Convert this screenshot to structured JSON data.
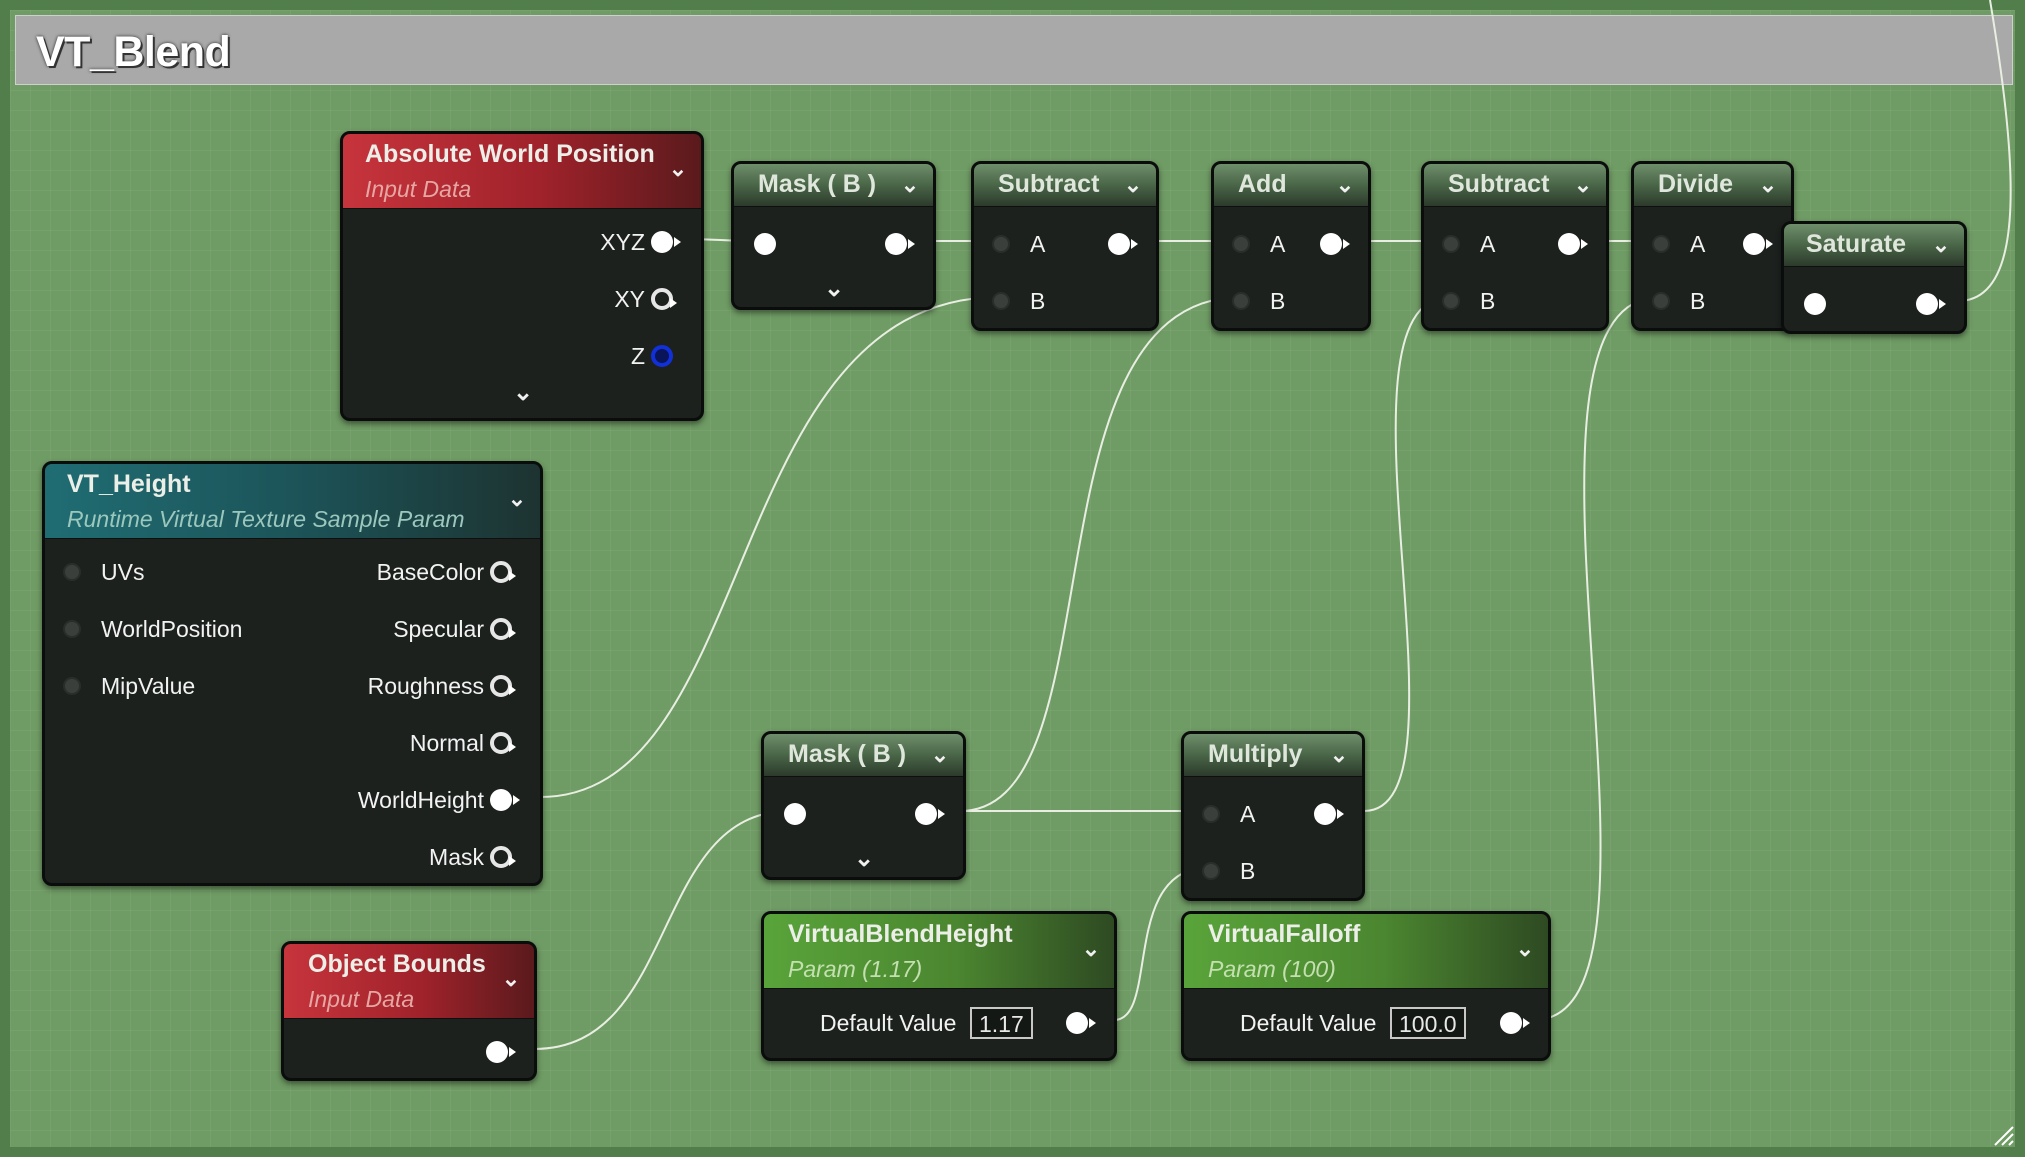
{
  "comment": {
    "title": "VT_Blend"
  },
  "nodes": {
    "absolute_world_position": {
      "title": "Absolute World Position",
      "subtitle": "Input Data",
      "outputs": [
        "XYZ",
        "XY",
        "Z"
      ]
    },
    "mask_top": {
      "title": "Mask ( B )"
    },
    "subtract_1": {
      "title": "Subtract",
      "inputs": [
        "A",
        "B"
      ]
    },
    "add": {
      "title": "Add",
      "inputs": [
        "A",
        "B"
      ]
    },
    "subtract_2": {
      "title": "Subtract",
      "inputs": [
        "A",
        "B"
      ]
    },
    "divide": {
      "title": "Divide",
      "inputs": [
        "A",
        "B"
      ]
    },
    "saturate": {
      "title": "Saturate"
    },
    "vt_height": {
      "title": "VT_Height",
      "subtitle": "Runtime Virtual Texture Sample Param",
      "inputs": [
        "UVs",
        "WorldPosition",
        "MipValue"
      ],
      "outputs": [
        "BaseColor",
        "Specular",
        "Roughness",
        "Normal",
        "WorldHeight",
        "Mask"
      ]
    },
    "mask_bottom": {
      "title": "Mask ( B )"
    },
    "multiply": {
      "title": "Multiply",
      "inputs": [
        "A",
        "B"
      ]
    },
    "object_bounds": {
      "title": "Object Bounds",
      "subtitle": "Input Data"
    },
    "virtual_blend_height": {
      "title": "VirtualBlendHeight",
      "subtitle": "Param (1.17)",
      "default_label": "Default Value",
      "default_value": "1.17"
    },
    "virtual_falloff": {
      "title": "VirtualFalloff",
      "subtitle": "Param (100)",
      "default_label": "Default Value",
      "default_value": "100.0"
    }
  },
  "colors": {
    "canvas": "#6f9b64",
    "comment_bar": "#a9a9a9",
    "wire": "#e8efe2",
    "red_header": "#b82a33",
    "teal_header": "#1f6d73",
    "green_header": "#59a43a"
  },
  "icons": {
    "dropdown": "chevron-down-icon",
    "resize": "resize-grip-icon"
  }
}
